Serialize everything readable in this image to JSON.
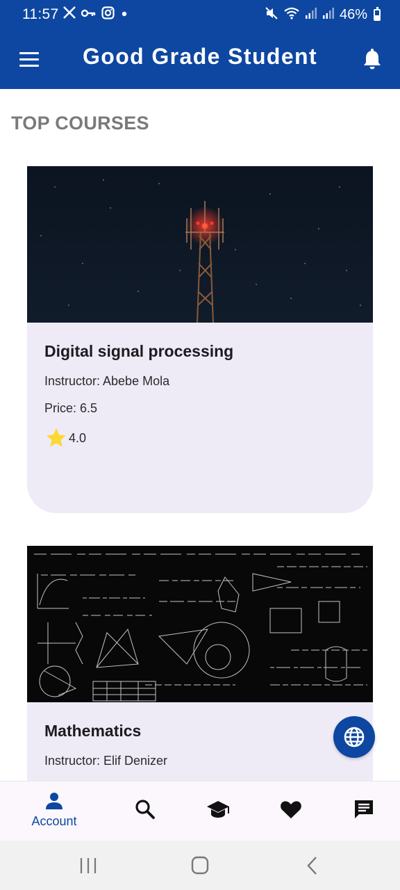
{
  "status_bar": {
    "time": "11:57",
    "left_icons": [
      "x-icon",
      "key-icon",
      "instagram-icon",
      "dot-icon"
    ],
    "right_icons": [
      "mute-icon",
      "wifi-icon",
      "signal-icon",
      "signal-icon"
    ],
    "battery": "46%"
  },
  "app_bar": {
    "title": "Good Grade Student",
    "left_icon": "menu-icon",
    "right_icon": "bell-icon",
    "background": "#0d47a1"
  },
  "section": {
    "title": "TOP COURSES"
  },
  "courses": [
    {
      "title": "Digital signal processing",
      "instructor": "Instructor: Abebe Mola",
      "price": "Price: 6.5",
      "rating": "4.0",
      "image": "cell-tower-at-night"
    },
    {
      "title": "Mathematics",
      "instructor": "Instructor: Elif Denizer",
      "image": "math-formulas-blackboard"
    }
  ],
  "fab": {
    "icon": "globe-icon"
  },
  "bottom_nav": {
    "items": [
      {
        "icon": "person-icon",
        "label": "Account",
        "active": true
      },
      {
        "icon": "search-icon"
      },
      {
        "icon": "graduation-cap-icon"
      },
      {
        "icon": "heart-icon"
      },
      {
        "icon": "chat-icon"
      }
    ],
    "active_color": "#0d47a1"
  },
  "system_nav": {
    "buttons": [
      "recents-icon",
      "home-icon",
      "back-icon"
    ]
  },
  "colors": {
    "primary": "#0d47a1",
    "card_bg": "#eeebf7",
    "star": "#fdd835"
  }
}
